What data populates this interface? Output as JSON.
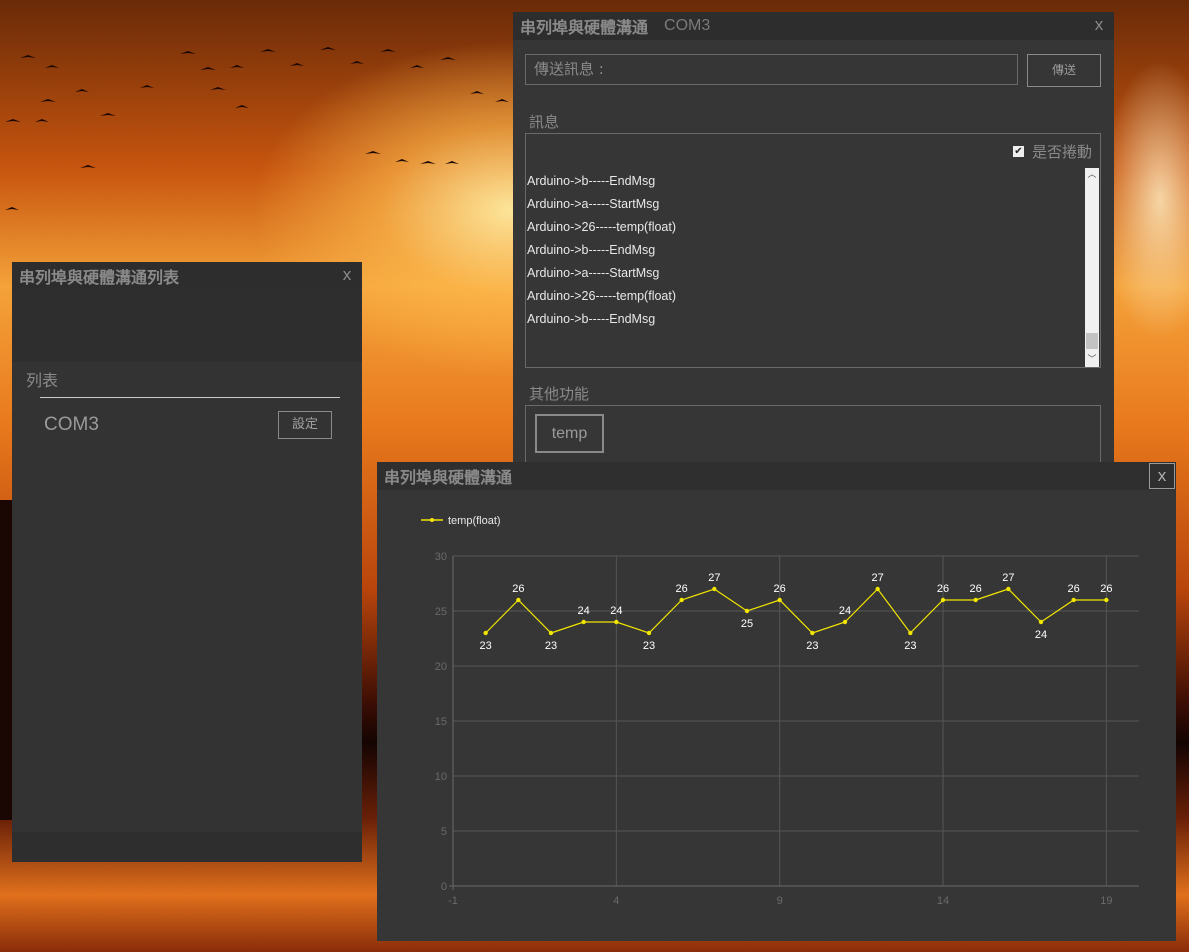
{
  "list_window": {
    "title": "串列埠與硬體溝通列表",
    "close": "x",
    "list_label": "列表",
    "ports": [
      {
        "name": "COM3",
        "button": "設定"
      }
    ]
  },
  "comm_window": {
    "title": "串列埠與硬體溝通",
    "port": "COM3",
    "close": "x",
    "send_placeholder": "傳送訊息 :",
    "send_button": "傳送",
    "messages_label": "訊息",
    "autoscroll_label": "是否捲動",
    "autoscroll_checked": true,
    "messages": [
      "Arduino->b-----EndMsg",
      "Arduino->a-----StartMsg",
      "Arduino->26-----temp(float)",
      "Arduino->b-----EndMsg",
      "Arduino->a-----StartMsg",
      "Arduino->26-----temp(float)",
      "Arduino->b-----EndMsg"
    ],
    "other_label": "其他功能",
    "func_button": "temp"
  },
  "chart_window": {
    "title": "串列埠與硬體溝通",
    "close": "x"
  },
  "chart_data": {
    "type": "line",
    "legend": "temp(float)",
    "legend_position": "top-left",
    "series": [
      {
        "name": "temp(float)",
        "x": [
          0,
          1,
          2,
          3,
          4,
          5,
          6,
          7,
          8,
          9,
          10,
          11,
          12,
          13,
          14,
          15,
          16,
          17,
          18,
          19
        ],
        "values": [
          23,
          26,
          23,
          24,
          24,
          23,
          26,
          27,
          25,
          26,
          23,
          24,
          27,
          23,
          26,
          26,
          27,
          24,
          26,
          26
        ]
      }
    ],
    "xlim": [
      -1,
      20
    ],
    "ylim": [
      0,
      30
    ],
    "xticks": [
      -1,
      4,
      9,
      14,
      19
    ],
    "yticks": [
      0,
      5,
      10,
      15,
      20,
      25,
      30
    ],
    "label_below": [
      true,
      false,
      true,
      false,
      false,
      true,
      false,
      false,
      true,
      false,
      true,
      false,
      false,
      true,
      false,
      false,
      false,
      true,
      false,
      false
    ],
    "grid": true,
    "colors": {
      "line": "#f2e600",
      "labels": "#ffffff",
      "grid": "#555555",
      "axis": "#6a6a6a"
    }
  }
}
